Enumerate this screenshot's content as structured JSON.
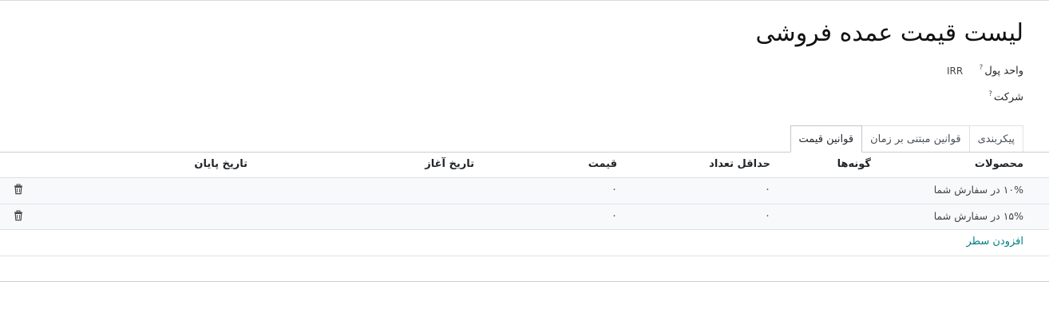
{
  "form": {
    "title": "لیست قیمت عمده فروشی",
    "currency_label": "واحد پول",
    "currency_value": "IRR",
    "company_label": "شرکت",
    "help_mark": "?"
  },
  "tabs": [
    {
      "label": "قوانین قیمت",
      "active": true
    },
    {
      "label": "قوانین مبتنی بر زمان",
      "active": false
    },
    {
      "label": "پیکربندی",
      "active": false
    }
  ],
  "table": {
    "headers": {
      "products": "محصولات",
      "variants": "گونه‌ها",
      "min_qty": "حداقل تعداد",
      "price": "قیمت",
      "start_date": "تاریخ آغاز",
      "end_date": "تاریخ پایان"
    },
    "rows": [
      {
        "product": "۱۰% در سفارش شما",
        "variant": "",
        "min_qty": "۰",
        "price": "۰",
        "start_date": "",
        "end_date": ""
      },
      {
        "product": "۱۵% در سفارش شما",
        "variant": "",
        "min_qty": "۰",
        "price": "۰",
        "start_date": "",
        "end_date": ""
      }
    ],
    "add_line": "افزودن سطر"
  },
  "icons": {
    "delete": "trash-icon",
    "help": "question-mark"
  }
}
